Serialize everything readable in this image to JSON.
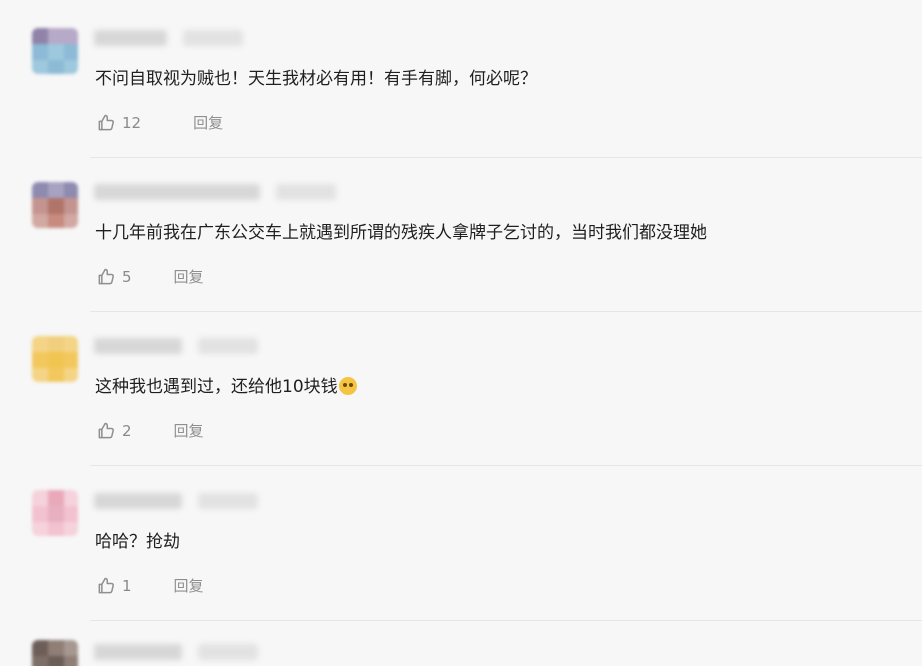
{
  "comments": [
    {
      "text": "不问自取视为贼也！天生我材必有用！有手有脚，何必呢？",
      "likes": "12",
      "reply": "回复",
      "has_emoji": false,
      "avatar_colors": [
        "#8f83a8",
        "#b6aac8",
        "#8dbad6",
        "#9dc8dd"
      ]
    },
    {
      "text": "十几年前我在广东公交车上就遇到所谓的残疾人拿牌子乞讨的，当时我们都没理她",
      "likes": "5",
      "reply": "回复",
      "has_emoji": false,
      "avatar_colors": [
        "#8e8ab0",
        "#c49490",
        "#b07468",
        "#d1a8a2"
      ]
    },
    {
      "text": "这种我也遇到过，还给他10块钱",
      "likes": "2",
      "reply": "回复",
      "has_emoji": true,
      "avatar_colors": [
        "#f0cf7e",
        "#f2c85e",
        "#f4d486",
        "#f0c552"
      ]
    },
    {
      "text": "哈哈？抢劫",
      "likes": "1",
      "reply": "回复",
      "has_emoji": false,
      "avatar_colors": [
        "#f3c2cf",
        "#e9a9ba",
        "#f5d2dc",
        "#e7b0c0"
      ]
    }
  ],
  "partial_comment": {
    "avatar_colors": [
      "#6d5d58",
      "#8f7f77",
      "#a69891",
      "#7d6f68"
    ]
  }
}
